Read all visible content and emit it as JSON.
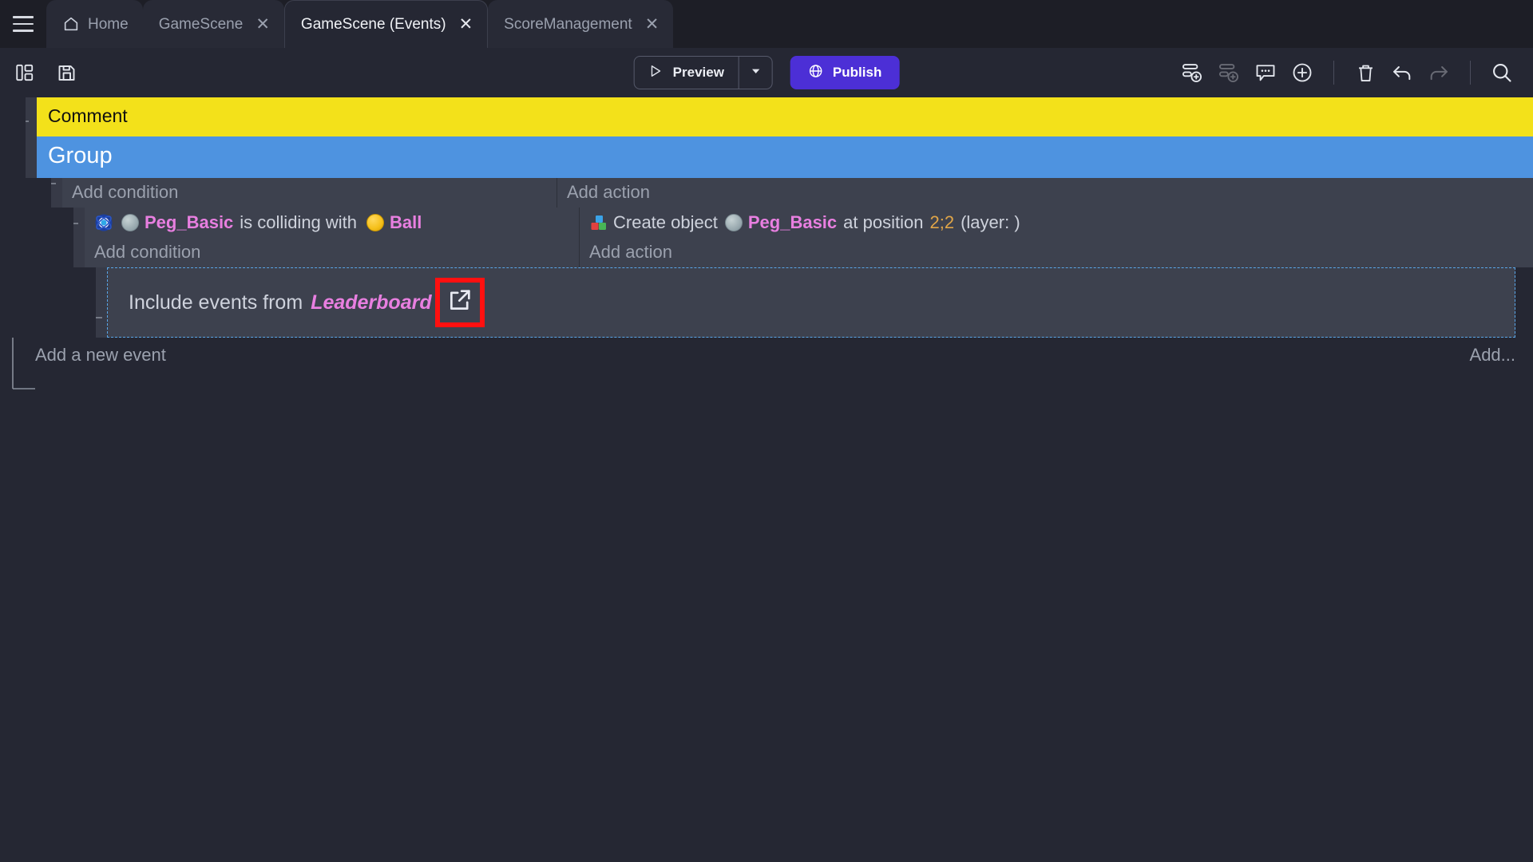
{
  "window": {
    "menu_icon": "hamburger-menu-icon",
    "background": "#252733"
  },
  "tabs": [
    {
      "label": "Home",
      "icon": "home-icon",
      "closable": false,
      "active": false
    },
    {
      "label": "GameScene",
      "icon": null,
      "closable": true,
      "active": false,
      "close_glyph": "✕"
    },
    {
      "label": "GameScene (Events)",
      "icon": null,
      "closable": true,
      "active": true,
      "close_glyph": "✕"
    },
    {
      "label": "ScoreManagement",
      "icon": null,
      "closable": true,
      "active": false,
      "close_glyph": "✕"
    }
  ],
  "toolbar": {
    "left_icons": [
      {
        "name": "open-project-manager-icon"
      },
      {
        "name": "save-icon"
      }
    ],
    "preview_label": "Preview",
    "preview_icon": "play-triangle-icon",
    "preview_caret_icon": "chevron-down-icon",
    "publish_label": "Publish",
    "publish_icon": "globe-icon",
    "publish_color": "#4c2fd6",
    "right_icons": [
      {
        "name": "add-event-icon",
        "dimmed": false
      },
      {
        "name": "add-sub-event-icon",
        "dimmed": true
      },
      {
        "name": "add-comment-icon",
        "dimmed": false
      },
      {
        "name": "add-circle-icon",
        "dimmed": false
      },
      {
        "name": "delete-icon",
        "dimmed": false
      },
      {
        "name": "undo-icon",
        "dimmed": false
      },
      {
        "name": "redo-icon",
        "dimmed": true
      },
      {
        "name": "search-icon",
        "dimmed": false
      }
    ]
  },
  "events": {
    "comment": {
      "text": "Comment",
      "background": "#f3e11a",
      "text_color": "#101010"
    },
    "group": {
      "text": "Group",
      "background": "#4e93e0",
      "text_color": "#ffffff"
    },
    "add_condition_label": "Add condition",
    "add_action_label": "Add action",
    "condition": {
      "icon": "collision-behavior-icon",
      "object_a": "Peg_Basic",
      "object_a_thumb": "circle-gray-peg",
      "middle_text": "is colliding with",
      "object_b": "Ball",
      "object_b_thumb": "circle-yellow-ball"
    },
    "action": {
      "icon": "create-object-icon",
      "prefix": "Create object",
      "object": "Peg_Basic",
      "object_thumb": "circle-gray-peg",
      "mid": "at position",
      "position_x": "2",
      "position_sep": ";",
      "position_y": "2",
      "suffix": "(layer: )"
    },
    "link": {
      "prefix": "Include events from",
      "target": "Leaderboard",
      "open_icon": "external-link-icon",
      "highlight_color": "#ff1010",
      "border_color": "#59a6e8"
    },
    "add_new_event_label": "Add a new event",
    "add_right_label": "Add..."
  },
  "colors": {
    "object_name": "#e87fe0",
    "number": "#e0a548",
    "instruction_text": "#ced2dc",
    "placeholder": "#9ba1ae",
    "row_bg": "#3d414e"
  }
}
